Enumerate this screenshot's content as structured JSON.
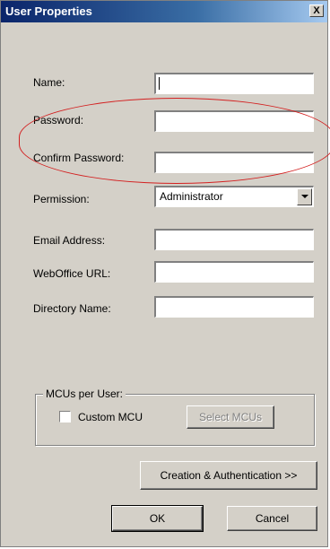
{
  "window": {
    "title": "User Properties",
    "close_label": "X"
  },
  "form": {
    "name_label": "Name:",
    "name_value": "",
    "password_label": "Password:",
    "password_value": "",
    "confirm_label": "Confirm Password:",
    "confirm_value": "",
    "permission_label": "Permission:",
    "permission_value": "Administrator",
    "email_label": "Email Address:",
    "email_value": "",
    "weboffice_label": "WebOffice URL:",
    "weboffice_value": "",
    "directory_label": "Directory Name:",
    "directory_value": ""
  },
  "mcu": {
    "group_title": "MCUs per User:",
    "custom_label": "Custom MCU",
    "custom_checked": false,
    "select_button": "Select MCUs"
  },
  "buttons": {
    "creation": "Creation & Authentication >>",
    "ok": "OK",
    "cancel": "Cancel"
  },
  "colors": {
    "dialog_bg": "#d4d0c8",
    "titlebar_start": "#0a246a",
    "highlight": "#d32020"
  }
}
